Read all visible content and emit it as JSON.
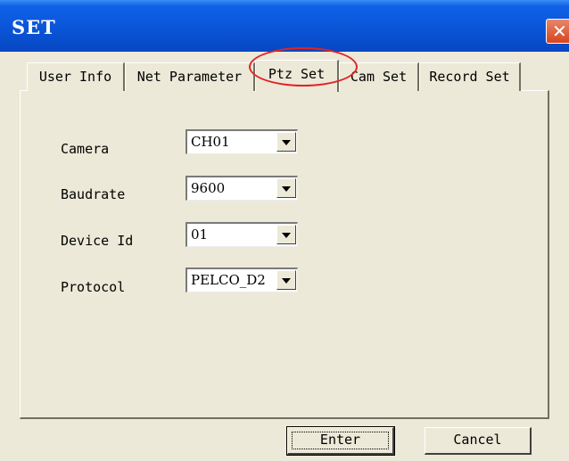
{
  "window": {
    "title": "SET"
  },
  "tabs": [
    {
      "label": "User Info"
    },
    {
      "label": "Net Parameter"
    },
    {
      "label": "Ptz Set",
      "active": true
    },
    {
      "label": "Cam Set"
    },
    {
      "label": "Record Set"
    }
  ],
  "fields": [
    {
      "label": "Camera",
      "value": "CH01"
    },
    {
      "label": "Baudrate",
      "value": "9600"
    },
    {
      "label": "Device Id",
      "value": "01"
    },
    {
      "label": "Protocol",
      "value": "PELCO_D2"
    }
  ],
  "buttons": {
    "enter": "Enter",
    "cancel": "Cancel"
  },
  "colors": {
    "titlebar": "#0a55d8",
    "dialog_bg": "#ece9d8",
    "highlight_circle": "#e02424",
    "close_button": "#d5451e"
  },
  "icons": {
    "close": "close-icon",
    "dropdown": "chevron-down-icon"
  }
}
